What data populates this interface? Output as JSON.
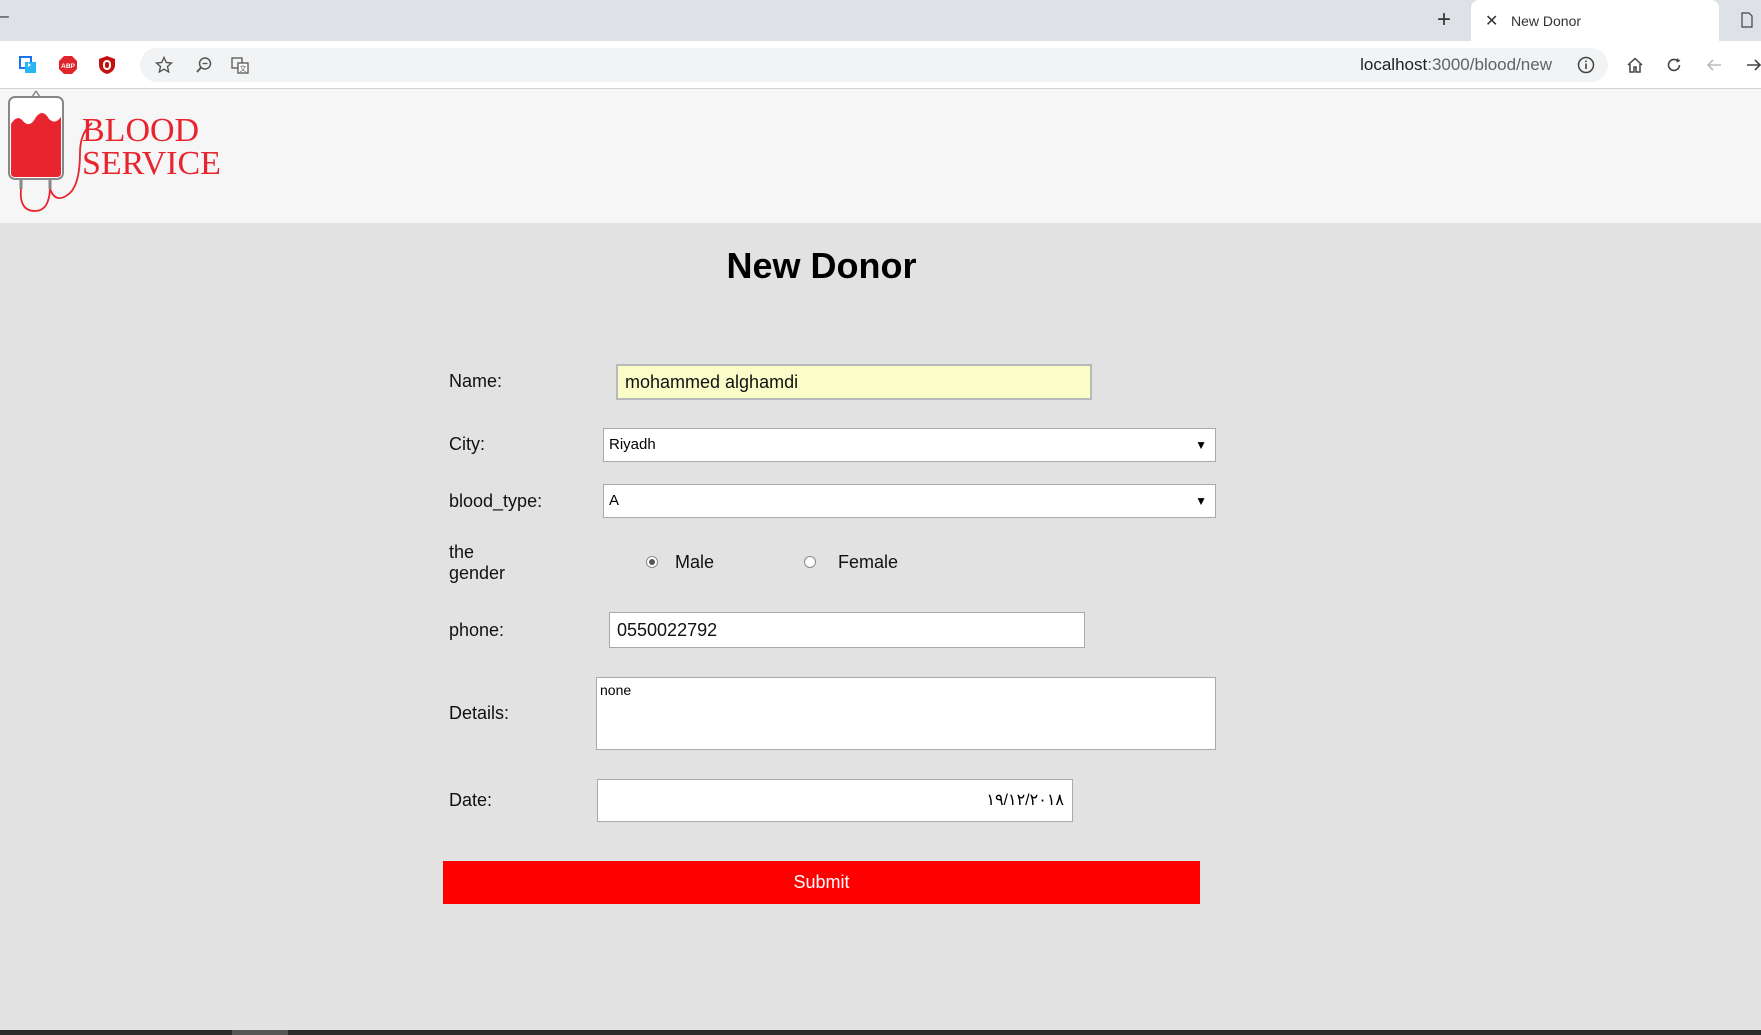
{
  "browser": {
    "tab_title": "New Donor",
    "url_host": "localhost",
    "url_path": ":3000/blood/new"
  },
  "site": {
    "logo_text_line1": "BLOOD",
    "logo_text_line2": "SERVICE",
    "brand_color": "#e8242f"
  },
  "form": {
    "title": "New Donor",
    "name_label": "Name:",
    "name_value": "mohammed alghamdi",
    "city_label": "City:",
    "city_value": "Riyadh",
    "blood_type_label": "blood_type:",
    "blood_type_value": "A",
    "gender_label_line1": "the",
    "gender_label_line2": "gender",
    "gender_options": [
      {
        "label": "Male",
        "checked": true
      },
      {
        "label": "Female",
        "checked": false
      }
    ],
    "phone_label": "phone:",
    "phone_value": "0550022792",
    "details_label": "Details:",
    "details_value": "none",
    "date_label": "Date:",
    "date_value": "١٩/١٢/٢٠١٨",
    "submit_label": "Submit",
    "submit_color": "#ff0000"
  }
}
